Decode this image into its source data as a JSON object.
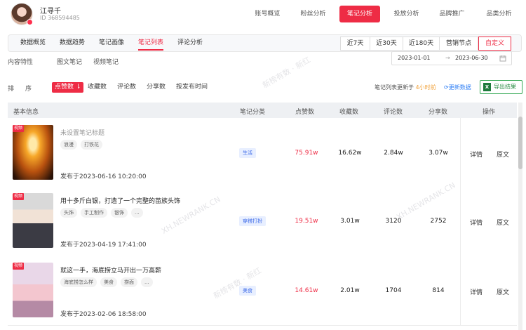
{
  "account": {
    "name": "江寻千",
    "id": "ID 368594485"
  },
  "topnav": [
    "账号概览",
    "粉丝分析",
    "笔记分析",
    "投放分析",
    "品牌推广",
    "品类分析"
  ],
  "subtabs": [
    "数据概览",
    "数据趋势",
    "笔记画像",
    "笔记列表",
    "评论分析"
  ],
  "ranges": [
    "近7天",
    "近30天",
    "近180天",
    "营销节点",
    "自定义"
  ],
  "content_type": {
    "label": "内容特性",
    "options": [
      "图文笔记",
      "视频笔记"
    ]
  },
  "date_range": {
    "start": "2023-01-01",
    "arrow": "→",
    "end": "2023-06-30"
  },
  "sort": {
    "label1": "排",
    "label2": "序",
    "options": [
      "点赞数",
      "收藏数",
      "评论数",
      "分享数",
      "按发布时间"
    ]
  },
  "update_note": {
    "prefix": "笔记列表更新于",
    "time": "4小时前"
  },
  "refresh_label": "更新数据",
  "export_label": "导出结果",
  "table": {
    "headers": [
      "基本信息",
      "笔记分类",
      "点赞数",
      "收藏数",
      "评论数",
      "分享数",
      "操作"
    ],
    "rows": [
      {
        "badge": "视频",
        "title": "未设置笔记标题",
        "tags": [
          "浪漫",
          "打铁花"
        ],
        "published": "发布于2023-06-16 10:20:00",
        "category": "生活",
        "likes": "75.91w",
        "favorites": "16.62w",
        "comments": "2.84w",
        "shares": "3.07w",
        "op1": "详情",
        "op2": "原文"
      },
      {
        "badge": "视频",
        "title": "用十多斤白银，打造了一个完整的苗族头饰",
        "tags": [
          "头饰",
          "手工制作",
          "银饰",
          "..."
        ],
        "published": "发布于2023-04-19 17:41:00",
        "category": "穿搭打扮",
        "likes": "19.51w",
        "favorites": "3.01w",
        "comments": "3120",
        "shares": "2752",
        "op1": "详情",
        "op2": "原文"
      },
      {
        "badge": "视频",
        "title": "就这一手，海底捞立马开出一万高薪",
        "tags": [
          "海底捞怎么样",
          "美食",
          "捞面",
          "..."
        ],
        "published": "发布于2023-02-06 18:58:00",
        "category": "美食",
        "likes": "14.61w",
        "favorites": "2.01w",
        "comments": "1704",
        "shares": "814",
        "op1": "详情",
        "op2": "原文"
      }
    ]
  },
  "watermark": [
    "新榜有数 · 新红",
    "XH.NEWRANK.CN"
  ],
  "colors": {
    "accent": "#ee2c45",
    "link": "#2f7ff5",
    "excel": "#1e7b3c",
    "update_time": "#f1a33d"
  }
}
